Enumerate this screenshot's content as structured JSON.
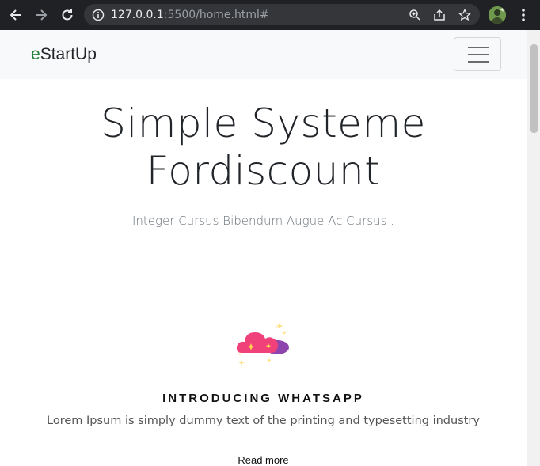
{
  "browser": {
    "url_host": "127.0.0.1",
    "url_rest": ":5500/home.html#"
  },
  "navbar": {
    "brand_first": "e",
    "brand_rest": "StartUp"
  },
  "hero": {
    "title_line1": "Simple Systeme",
    "title_line2": "Fordiscount",
    "subtitle": "Integer Cursus Bibendum Augue Ac Cursus ."
  },
  "feature": {
    "icon": "cloud-icon",
    "title": "INTRODUCING WHATSAPP",
    "text": "Lorem Ipsum is simply dummy text of the printing and typesetting industry",
    "link": "Read more"
  },
  "colors": {
    "chrome_bg": "#202124",
    "navbar_bg": "#f8f9fa",
    "brand_accent": "#1e7e34",
    "cloud_pink": "#f0417a",
    "cloud_purple": "#8e44ad"
  }
}
